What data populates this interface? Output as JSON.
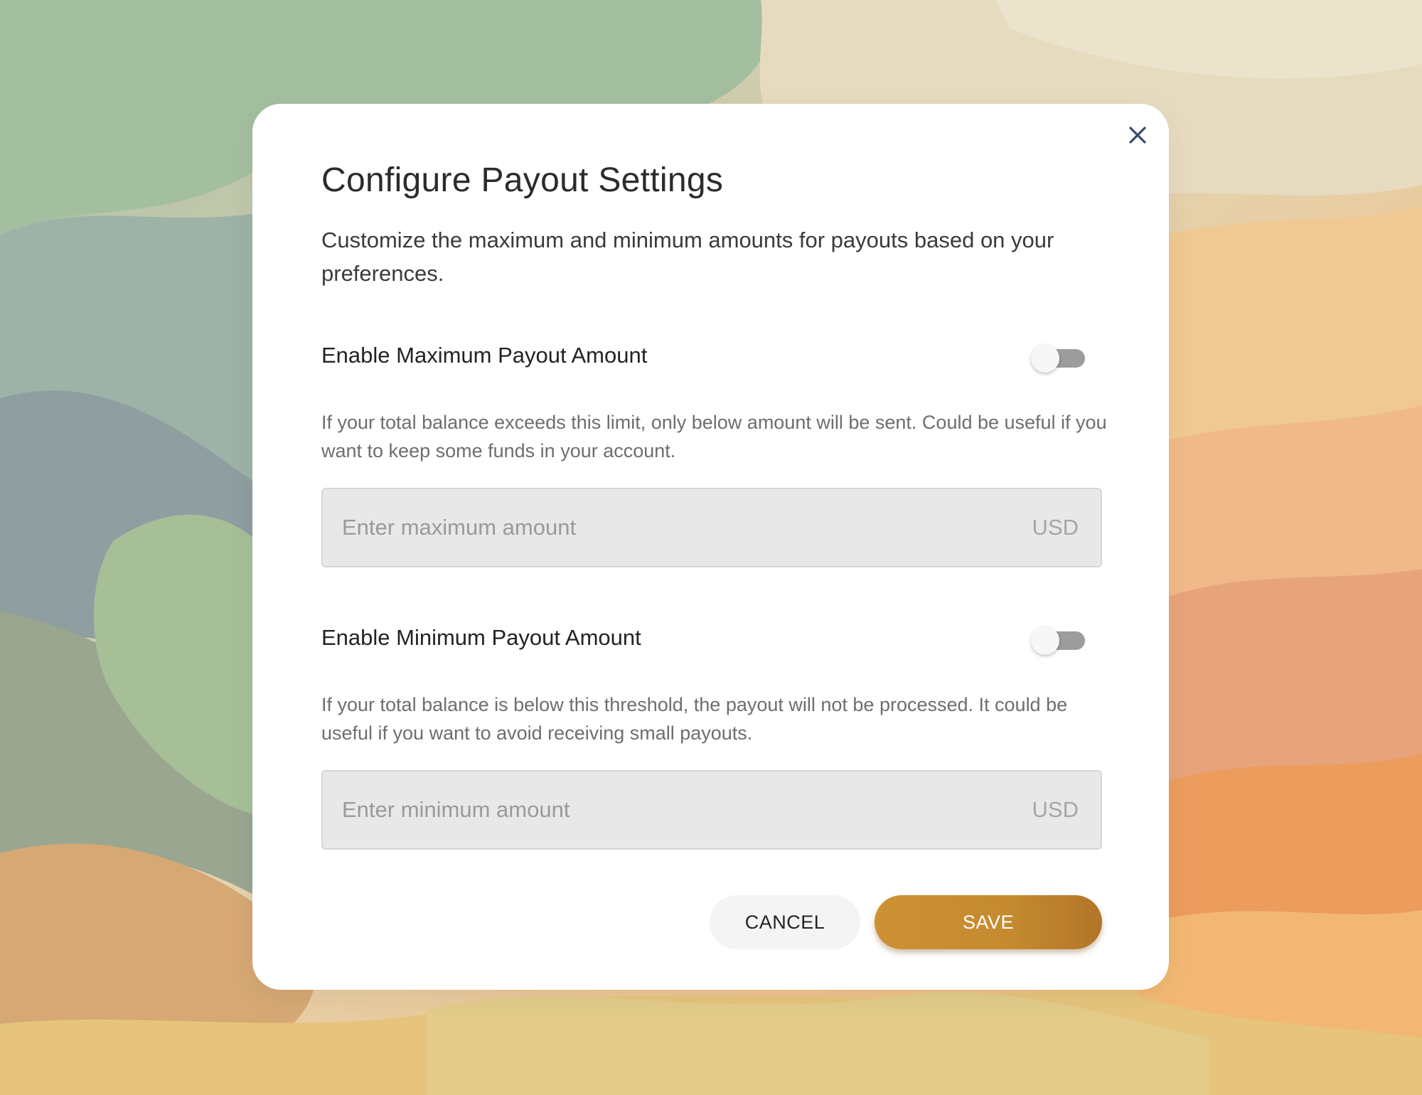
{
  "dialog": {
    "title": "Configure Payout Settings",
    "subtitle": "Customize the maximum and minimum amounts for payouts based on your preferences.",
    "close_icon": "close-icon"
  },
  "maximum": {
    "label": "Enable Maximum Payout Amount",
    "enabled": false,
    "help": "If your total balance exceeds this limit, only below amount will be sent. Could be useful if you want to keep some funds in your account.",
    "placeholder": "Enter maximum amount",
    "value": "",
    "currency": "USD"
  },
  "minimum": {
    "label": "Enable Minimum Payout Amount",
    "enabled": false,
    "help": "If your total balance is below this threshold, the payout will not be processed. It could be useful if you want to avoid receiving small payouts.",
    "placeholder": "Enter minimum amount",
    "value": "",
    "currency": "USD"
  },
  "actions": {
    "cancel_label": "CANCEL",
    "save_label": "SAVE"
  },
  "colors": {
    "accent": "#c58a2f",
    "toggle_off_track": "#9c9c9c",
    "field_background": "#e8e8e8"
  }
}
